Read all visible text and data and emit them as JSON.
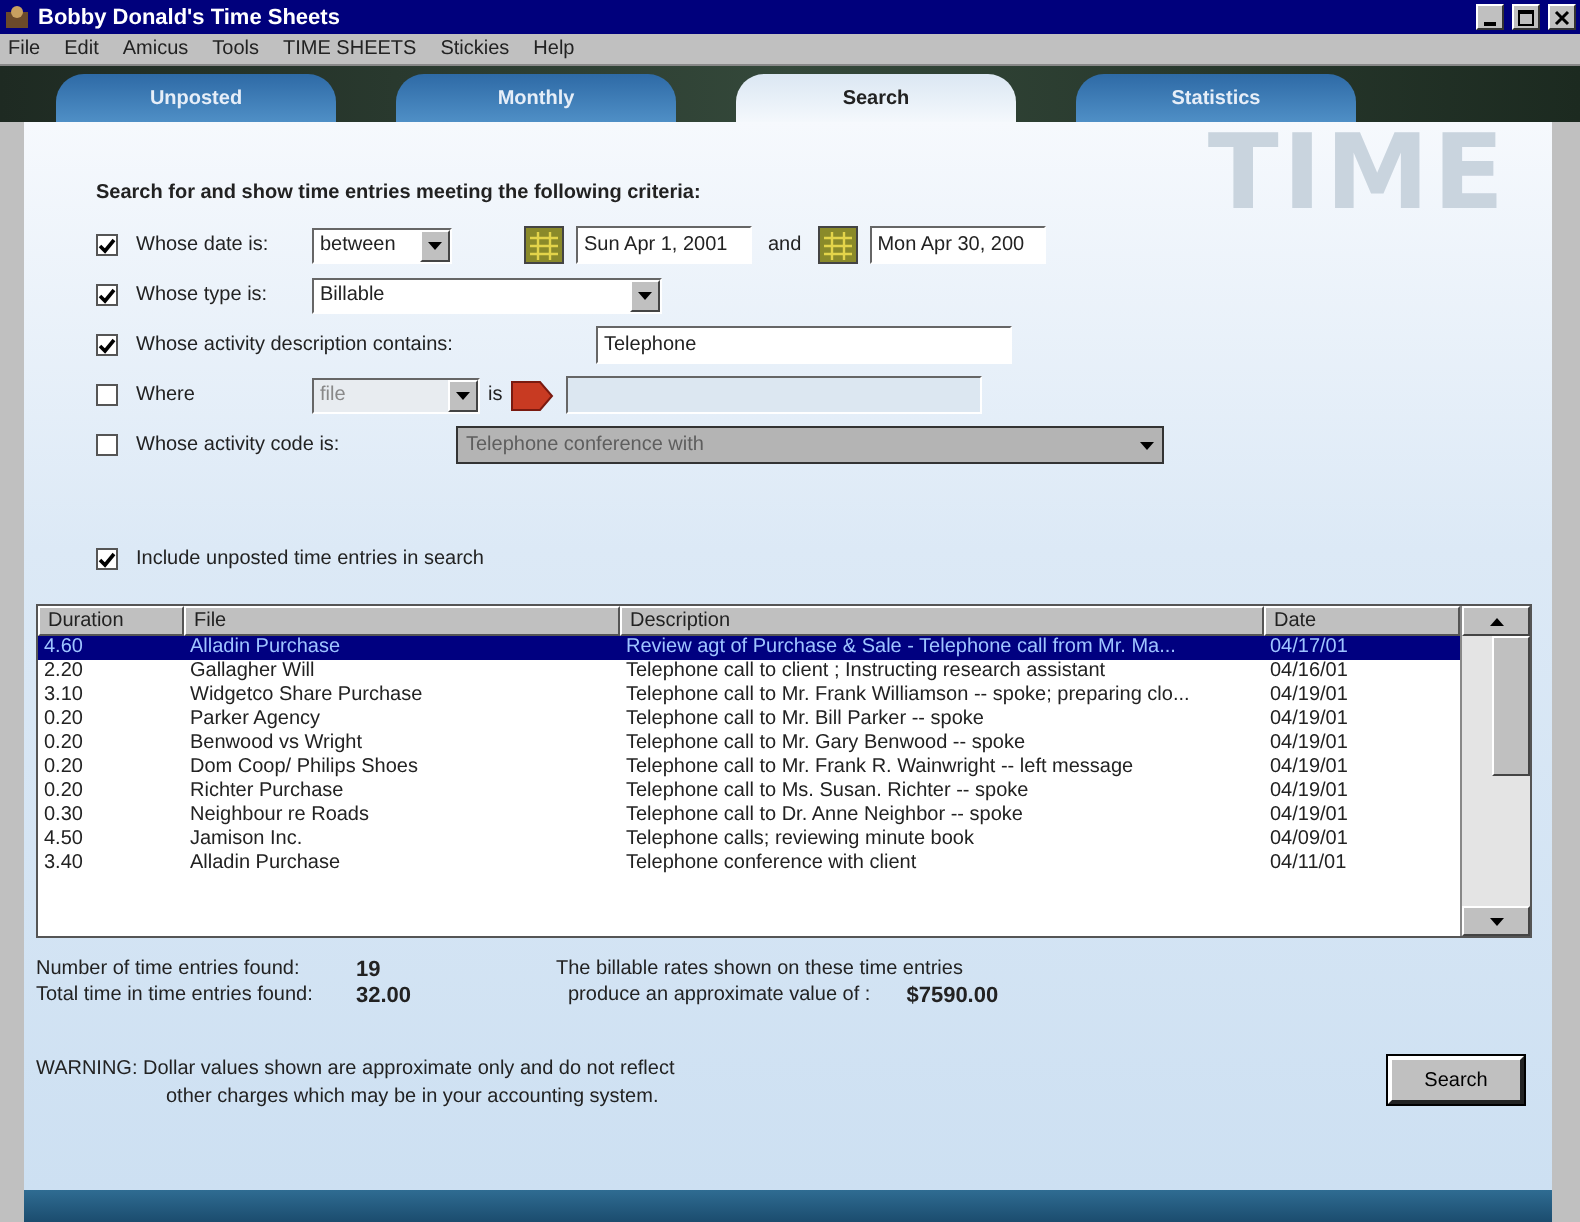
{
  "window": {
    "title": "Bobby Donald's Time Sheets"
  },
  "menu": [
    "File",
    "Edit",
    "Amicus",
    "Tools",
    "TIME SHEETS",
    "Stickies",
    "Help"
  ],
  "tabs": [
    {
      "label": "Unposted",
      "selected": false
    },
    {
      "label": "Monthly",
      "selected": false
    },
    {
      "label": "Search",
      "selected": true
    },
    {
      "label": "Statistics",
      "selected": false
    }
  ],
  "logo": "TIME",
  "heading": "Search for and show time entries meeting the following criteria:",
  "criteria": [
    {
      "kind": "date",
      "checked": true,
      "label": "Whose date is:",
      "operator": "between",
      "start": "Sun Apr 1, 2001",
      "joiner": "and",
      "end": "Mon Apr 30, 200"
    },
    {
      "kind": "select",
      "checked": true,
      "label": "Whose type is:",
      "value": "Billable"
    },
    {
      "kind": "text",
      "checked": true,
      "label": "Whose activity description contains:",
      "value": "Telephone"
    },
    {
      "kind": "where",
      "checked": false,
      "label": "Where",
      "field": "file",
      "joiner": "is"
    },
    {
      "kind": "code",
      "checked": false,
      "label": "Whose activity code is:",
      "value": "Telephone conference with"
    }
  ],
  "include": {
    "checked": true,
    "label": "Include unposted time entries in search"
  },
  "table": {
    "columns": [
      "Duration",
      "File",
      "Description",
      "Date"
    ],
    "rows": [
      {
        "cells": [
          "4.60",
          "Alladin Purchase",
          "Review agt of Purchase & Sale - Telephone call from Mr. Ma...",
          "04/17/01"
        ],
        "selected": true
      },
      {
        "cells": [
          "2.20",
          "Gallagher Will",
          "Telephone call to client ; Instructing research assistant",
          "04/16/01"
        ],
        "selected": false
      },
      {
        "cells": [
          "3.10",
          "Widgetco Share Purchase",
          "Telephone call to Mr. Frank Williamson -- spoke; preparing clo...",
          "04/19/01"
        ],
        "selected": false
      },
      {
        "cells": [
          "0.20",
          "Parker Agency",
          "Telephone call to Mr. Bill Parker -- spoke",
          "04/19/01"
        ],
        "selected": false
      },
      {
        "cells": [
          "0.20",
          "Benwood vs Wright",
          "Telephone call to Mr. Gary Benwood -- spoke",
          "04/19/01"
        ],
        "selected": false
      },
      {
        "cells": [
          "0.20",
          "Dom Coop/ Philips Shoes",
          "Telephone call to Mr. Frank R. Wainwright -- left message",
          "04/19/01"
        ],
        "selected": false
      },
      {
        "cells": [
          "0.20",
          "Richter Purchase",
          "Telephone call to Ms. Susan. Richter -- spoke",
          "04/19/01"
        ],
        "selected": false
      },
      {
        "cells": [
          "0.30",
          "Neighbour re Roads",
          "Telephone call to Dr. Anne Neighbor -- spoke",
          "04/19/01"
        ],
        "selected": false
      },
      {
        "cells": [
          "4.50",
          "Jamison Inc.",
          "Telephone calls; reviewing minute book",
          "04/09/01"
        ],
        "selected": false
      },
      {
        "cells": [
          "3.40",
          "Alladin Purchase",
          "Telephone conference with client",
          "04/11/01"
        ],
        "selected": false
      }
    ]
  },
  "summary": {
    "count_label": "Number of time entries found:",
    "count": "19",
    "total_label": "Total time in time entries found:",
    "total": "32.00",
    "value_line1": "The billable rates shown on these time entries",
    "value_line2": "produce an approximate value of :",
    "value": "$7590.00"
  },
  "warning": [
    "WARNING: Dollar values shown are approximate only and do not reflect",
    "other charges which may be in your accounting system."
  ],
  "buttons": [
    "Search"
  ]
}
